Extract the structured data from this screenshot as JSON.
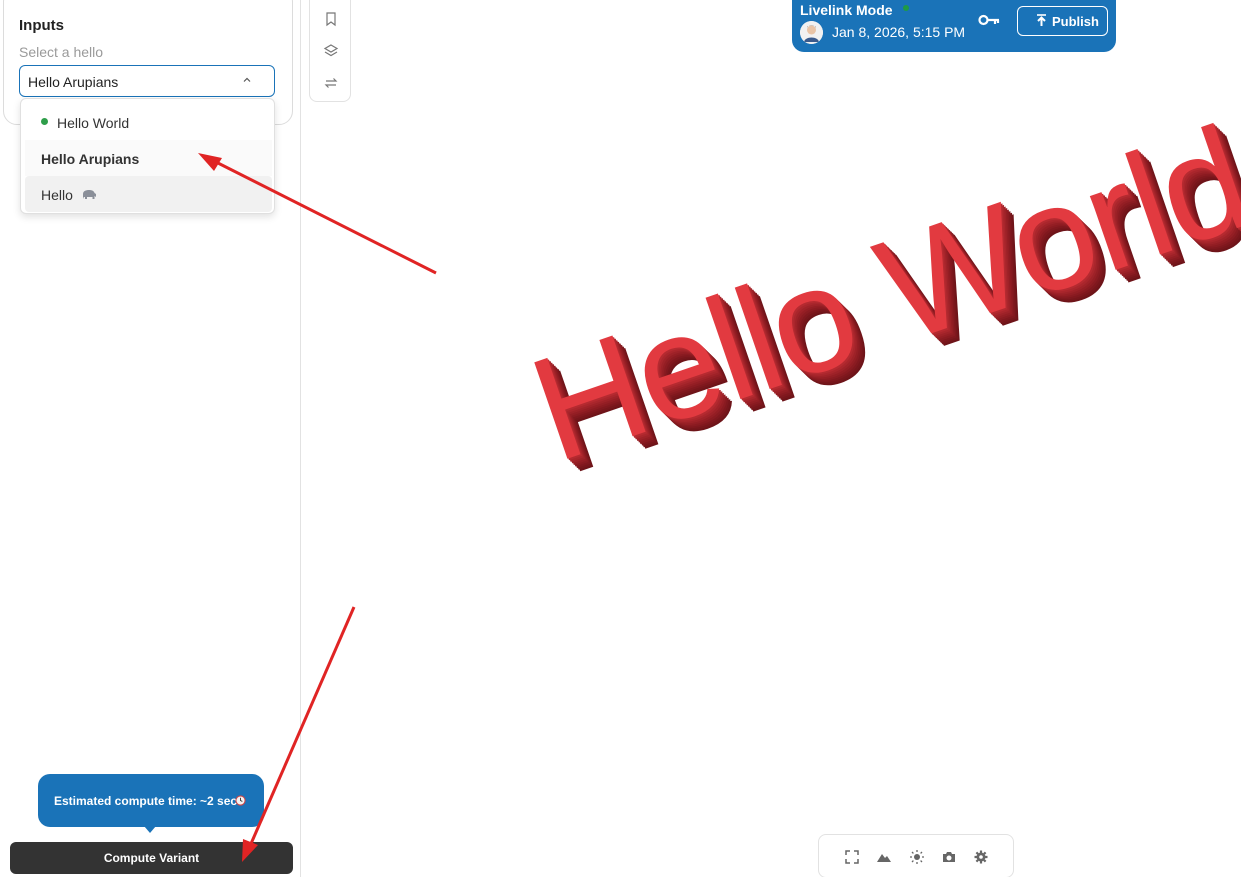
{
  "inputs": {
    "title": "Inputs",
    "select_label": "Select a hello",
    "selected_value": "Hello Arupians",
    "options": [
      {
        "label": "Hello World",
        "status": "active"
      },
      {
        "label": "Hello Arupians"
      },
      {
        "label": "Hello"
      }
    ]
  },
  "banner": {
    "title": "Livelink Mode",
    "date": "Jan 8, 2026, 5:15 PM",
    "publish_label": "Publish"
  },
  "viewport": {
    "model_text": "Hello World"
  },
  "tooltip": {
    "text": "Estimated compute time: ~2 sec"
  },
  "compute": {
    "label": "Compute Variant"
  },
  "colors": {
    "accent": "#1a73b8",
    "model_red": "#e23a40",
    "annotation_arrow": "#e02424",
    "status_green": "#2e9e4a"
  }
}
